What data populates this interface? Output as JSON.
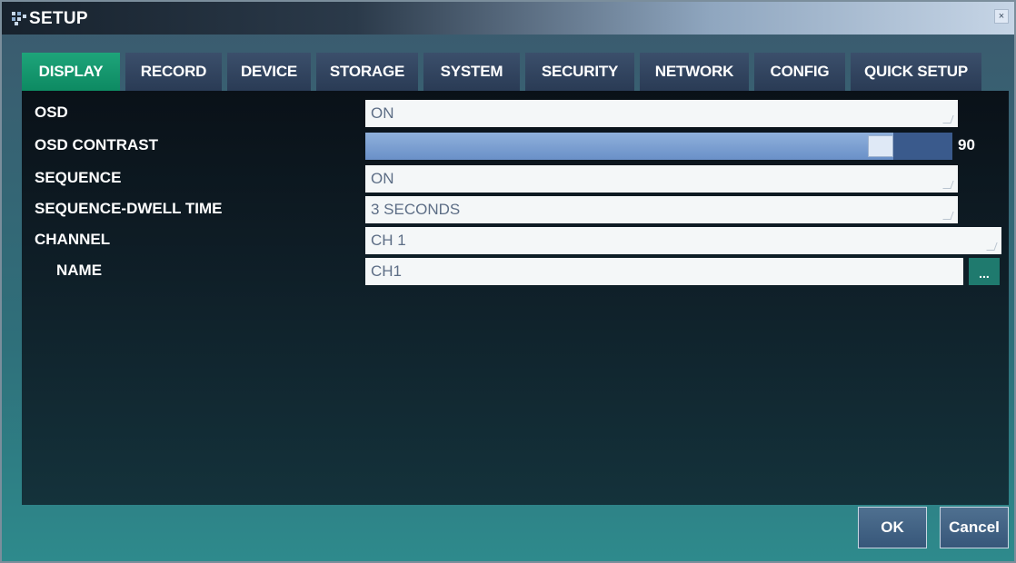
{
  "window": {
    "title": "SETUP",
    "icon": "grid-dots-icon",
    "close_glyph": "×"
  },
  "tabs": [
    {
      "label": "DISPLAY",
      "active": true
    },
    {
      "label": "RECORD",
      "active": false
    },
    {
      "label": "DEVICE",
      "active": false
    },
    {
      "label": "STORAGE",
      "active": false
    },
    {
      "label": "SYSTEM",
      "active": false
    },
    {
      "label": "SECURITY",
      "active": false
    },
    {
      "label": "NETWORK",
      "active": false
    },
    {
      "label": "CONFIG",
      "active": false
    },
    {
      "label": "QUICK SETUP",
      "active": false
    }
  ],
  "display": {
    "osd": {
      "label": "OSD",
      "value": "ON"
    },
    "osd_contrast": {
      "label": "OSD CONTRAST",
      "value": "90",
      "level_fraction": 0.9
    },
    "sequence": {
      "label": "SEQUENCE",
      "value": "ON"
    },
    "sequence_dwell_time": {
      "label": "SEQUENCE-DWELL TIME",
      "value": "3 SECONDS"
    },
    "channel": {
      "label": "CHANNEL",
      "value": "CH 1"
    },
    "name": {
      "label": "NAME",
      "value": "CH1",
      "edit_button": "..."
    }
  },
  "footer": {
    "ok_label": "OK",
    "cancel_label": "Cancel"
  },
  "colors": {
    "active_tab": "#1ea47a",
    "inactive_tab": "#2a3b55",
    "slider_fill": "#6a90c8",
    "dots_button": "#1f7a6e"
  }
}
